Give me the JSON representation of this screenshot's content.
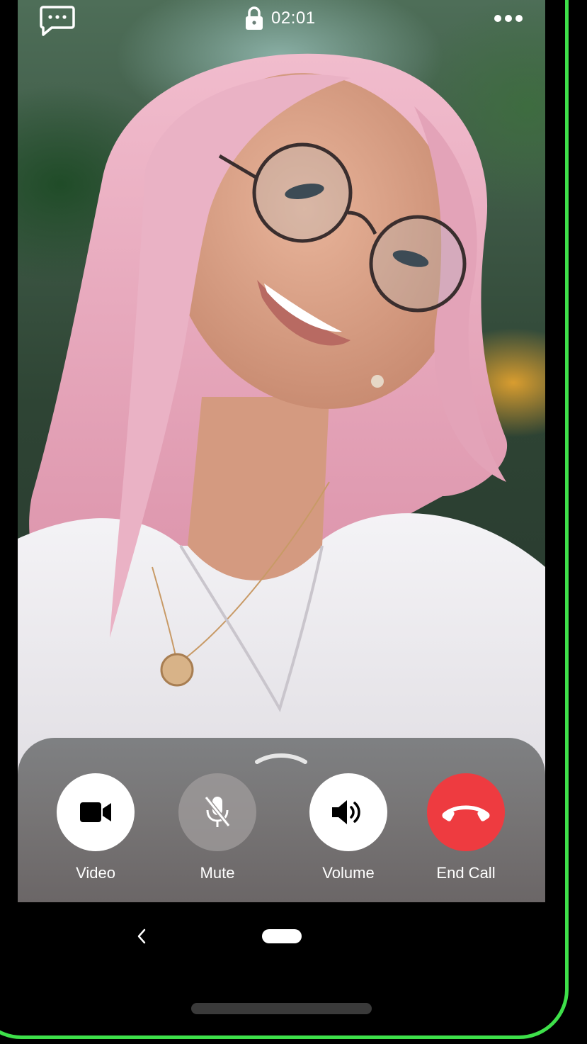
{
  "status_bar": {
    "call_timer": "02:01",
    "icons": [
      "chat-bubble-icon",
      "lock-icon",
      "more-options-icon"
    ]
  },
  "panel": {
    "handle_icon": "chevron-up-icon"
  },
  "controls": [
    {
      "label": "Video",
      "icon": "video-camera-icon",
      "active": true
    },
    {
      "label": "Mute",
      "icon": "microphone-off-icon",
      "active": false
    },
    {
      "label": "Volume",
      "icon": "speaker-volume-icon",
      "active": true
    },
    {
      "label": "End Call",
      "icon": "hang-up-icon",
      "color": "#ee3b40"
    }
  ],
  "nav": {
    "icons": [
      "back-icon",
      "home-pill",
      "gesture-bar"
    ]
  },
  "colors": {
    "frame_accent": "#3ee04a",
    "end_call": "#ee3b40"
  }
}
